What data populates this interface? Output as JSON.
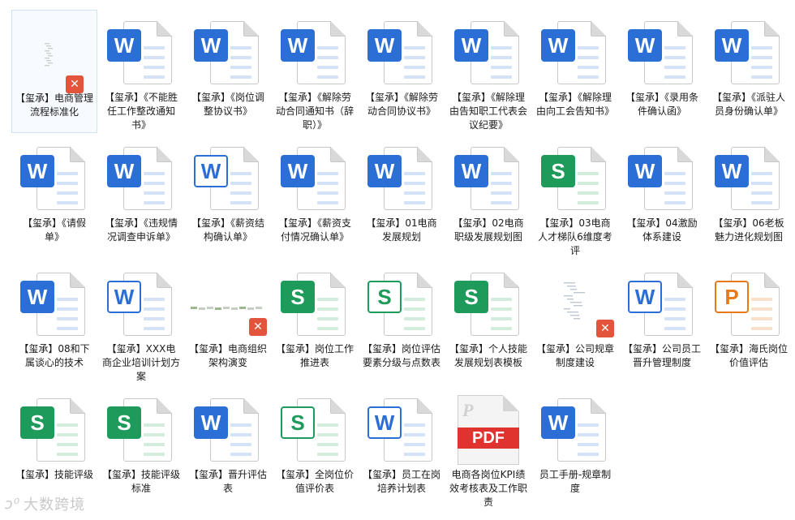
{
  "files": [
    {
      "type": "image",
      "label": "【玺承】电商管理流程标准化",
      "selected": true
    },
    {
      "type": "word",
      "label": "【玺承】《不能胜任工作整改通知书》"
    },
    {
      "type": "word",
      "label": "【玺承】《岗位调整协议书》"
    },
    {
      "type": "word",
      "label": "【玺承】《解除劳动合同通知书（辞职）》"
    },
    {
      "type": "word",
      "label": "【玺承】《解除劳动合同协议书》"
    },
    {
      "type": "word",
      "label": "【玺承】《解除理由告知职工代表会议纪要》"
    },
    {
      "type": "word",
      "label": "【玺承】《解除理由向工会告知书》"
    },
    {
      "type": "word",
      "label": "【玺承】《录用条件确认函》"
    },
    {
      "type": "word",
      "label": "【玺承】《派驻人员身份确认单》"
    },
    {
      "type": "word",
      "label": "【玺承】《请假单》"
    },
    {
      "type": "word",
      "label": "【玺承】《违规情况调查申诉单》"
    },
    {
      "type": "word",
      "alt": true,
      "label": "【玺承】《薪资结构确认单》"
    },
    {
      "type": "word",
      "label": "【玺承】《薪资支付情况确认单》"
    },
    {
      "type": "word",
      "label": "【玺承】01电商发展规划"
    },
    {
      "type": "word",
      "label": "【玺承】02电商职级发展规划图"
    },
    {
      "type": "excel",
      "label": "【玺承】03电商人才梯队6维度考评"
    },
    {
      "type": "word",
      "label": "【玺承】04激励体系建设"
    },
    {
      "type": "word",
      "label": "【玺承】06老板魅力进化规划图"
    },
    {
      "type": "word",
      "label": "【玺承】08和下属谈心的技术"
    },
    {
      "type": "word",
      "alt": true,
      "label": "【玺承】XXX电商企业培训计划方案"
    },
    {
      "type": "image",
      "label": "【玺承】电商组织架构演变"
    },
    {
      "type": "excel",
      "label": "【玺承】岗位工作推进表"
    },
    {
      "type": "excel",
      "alt": true,
      "label": "【玺承】岗位评估要素分级与点数表"
    },
    {
      "type": "excel",
      "label": "【玺承】个人技能发展规划表模板"
    },
    {
      "type": "image",
      "label": "【玺承】公司规章制度建设"
    },
    {
      "type": "word",
      "alt": true,
      "label": "【玺承】公司员工晋升管理制度"
    },
    {
      "type": "ppt",
      "label": "【玺承】海氏岗位价值评估"
    },
    {
      "type": "excel",
      "label": "【玺承】技能评级"
    },
    {
      "type": "excel",
      "label": "【玺承】技能评级标准"
    },
    {
      "type": "word",
      "label": "【玺承】晋升评估表"
    },
    {
      "type": "excel",
      "alt": true,
      "label": "【玺承】全岗位价值评价表"
    },
    {
      "type": "word",
      "alt": true,
      "label": "【玺承】员工在岗培养计划表"
    },
    {
      "type": "pdf",
      "label": "电商各岗位KPI绩效考核表及工作职责"
    },
    {
      "type": "word",
      "label": "员工手册-规章制度"
    }
  ],
  "badge_letters": {
    "word": "W",
    "excel": "S",
    "ppt": "P",
    "pdf": "PDF",
    "xmind": "✕"
  },
  "watermark": "大数跨境",
  "colors": {
    "word": "#2b6fd6",
    "excel": "#1e9b5a",
    "ppt": "#e8791a",
    "pdf": "#e0322e",
    "xmind": "#e2543c"
  }
}
